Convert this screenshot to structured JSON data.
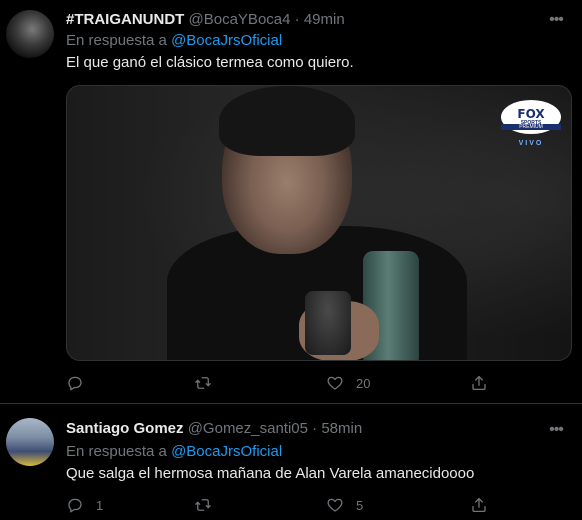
{
  "tweets": [
    {
      "name": "#TRAIGANUNDT",
      "handle": "@BocaYBoca4",
      "separator": "·",
      "time": "49min",
      "reply_prefix": "En respuesta a",
      "reply_to": "@BocaJrsOficial",
      "text": "El que ganó el clásico termea como quiero.",
      "media": {
        "logo_brand": "FOX",
        "logo_sub": "SPORTS",
        "logo_tier": "PREMIUM",
        "live_label": "VIVO"
      },
      "actions": {
        "reply_count": "",
        "retweet_count": "",
        "like_count": "20"
      }
    },
    {
      "name": "Santiago Gomez",
      "handle": "@Gomez_santi05",
      "separator": "·",
      "time": "58min",
      "reply_prefix": "En respuesta a",
      "reply_to": "@BocaJrsOficial",
      "text": "Que salga el hermosa mañana de Alan Varela amanecidoooo",
      "actions": {
        "reply_count": "1",
        "retweet_count": "",
        "like_count": "5"
      }
    }
  ],
  "icons": {
    "reply": "reply-icon",
    "retweet": "retweet-icon",
    "like": "heart-icon",
    "share": "share-icon",
    "more": "more-icon"
  },
  "colors": {
    "background": "#000000",
    "text_primary": "#e7e9ea",
    "text_secondary": "#71767b",
    "link": "#1d9bf0",
    "border": "#2f3336"
  }
}
